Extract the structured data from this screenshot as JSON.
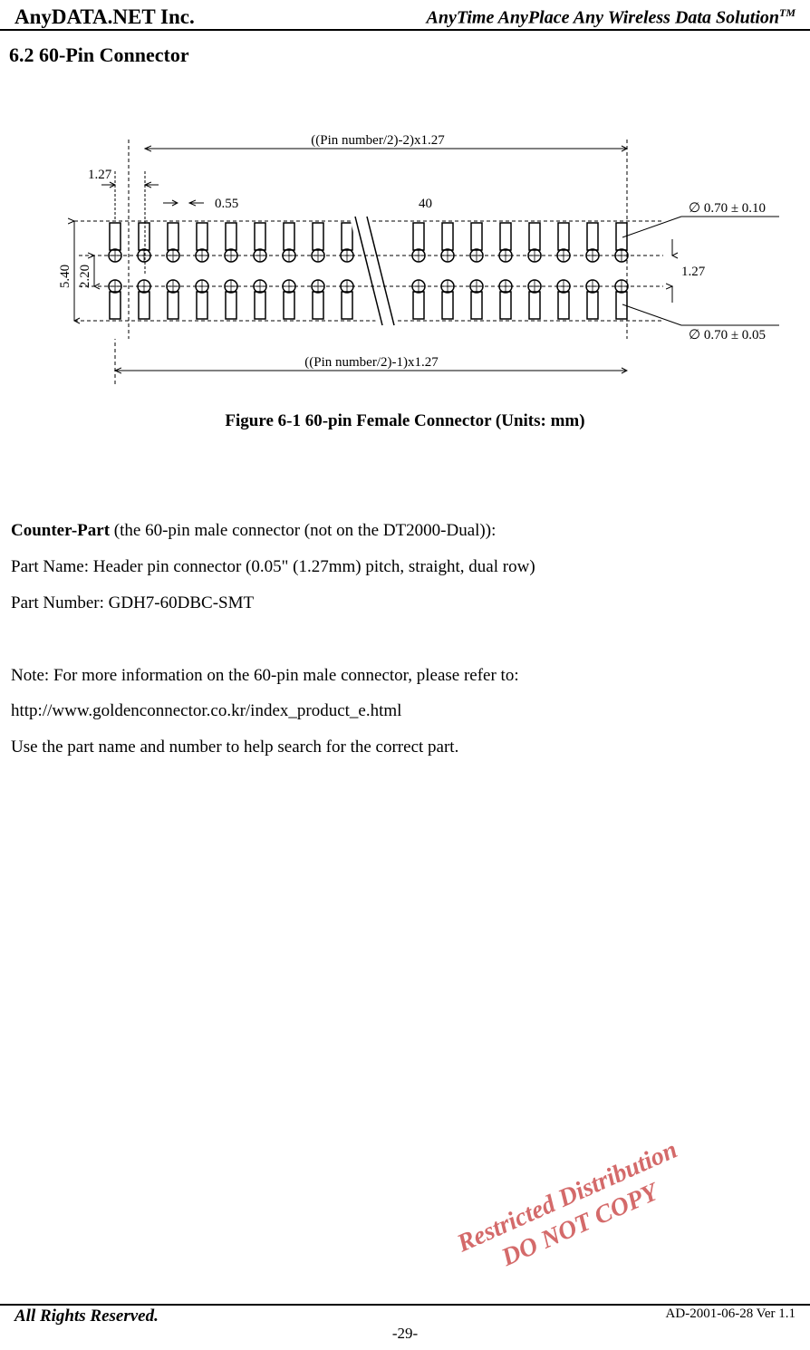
{
  "header": {
    "company": "AnyDATA.NET Inc.",
    "tagline_main": "AnyTime AnyPlace Any Wireless Data Solution",
    "tagline_tm": "TM"
  },
  "section": {
    "title": "6.2 60-Pin Connector"
  },
  "figure": {
    "caption": "Figure 6-1 60-pin Female Connector (Units: mm)",
    "labels": {
      "top_dim": "((Pin number/2)-2)x1.27",
      "bottom_dim": "((Pin number/2)-1)x1.27",
      "left_1_27": "1.27",
      "w_0_55": "0.55",
      "count_40": "40",
      "h_5_40": "5.40",
      "h_2_20": "2.20",
      "right_1_27": "1.27",
      "dia_top": "∅ 0.70 ± 0.10",
      "dia_bottom": "∅ 0.70 ± 0.05"
    }
  },
  "body": {
    "counter_part_label": "Counter-Part",
    "counter_part_rest": " (the 60-pin male connector (not on the DT2000-Dual)):",
    "part_name": "Part Name: Header pin connector (0.05\" (1.27mm) pitch, straight, dual row)",
    "part_number": "Part Number: GDH7-60DBC-SMT",
    "note_line": "Note: For more information on the 60-pin male connector, please refer to:",
    "url": "http://www.goldenconnector.co.kr/index_product_e.html",
    "use_line": "Use the part name and number to help search for the correct part."
  },
  "watermark": {
    "line1": "Restricted Distribution",
    "line2": "DO NOT COPY"
  },
  "footer": {
    "left": "All Rights Reserved.",
    "right": "AD-2001-06-28 Ver 1.1",
    "center": "-29-"
  }
}
